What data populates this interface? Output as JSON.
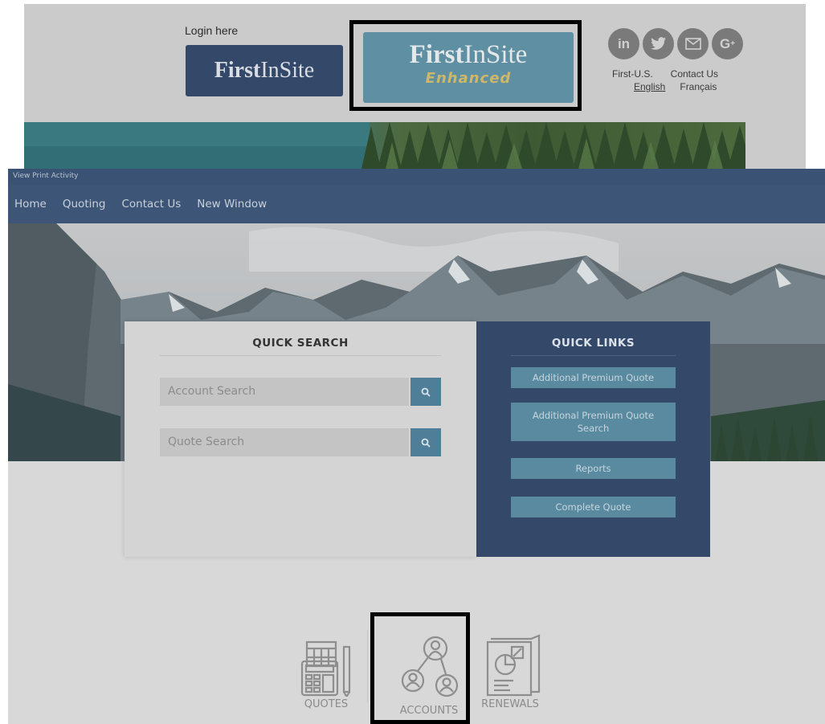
{
  "login": {
    "label": "Login here",
    "classic_bold": "First",
    "classic_light": "InSite",
    "enhanced_bold": "First",
    "enhanced_light": "InSite",
    "enhanced_sub": "Enhanced"
  },
  "social": {
    "items": [
      "in",
      "t",
      "mail",
      "G+"
    ],
    "first_us": "First-U.S.",
    "contact_us": "Contact Us",
    "english": "English",
    "francais": "Français"
  },
  "app": {
    "title_bar": "View Print Activity",
    "nav": [
      "Home",
      "Quoting",
      "Contact Us",
      "New Window"
    ]
  },
  "quick_search": {
    "title": "QUICK SEARCH",
    "account_placeholder": "Account Search",
    "quote_placeholder": "Quote Search"
  },
  "quick_links": {
    "title": "QUICK LINKS",
    "items": [
      "Additional Premium Quote",
      "Additional Premium Quote Search",
      "Reports",
      "Complete Quote"
    ]
  },
  "bottom_tabs": {
    "quotes": "QUOTES",
    "accounts": "ACCOUNTS",
    "renewals": "RENEWALS"
  },
  "colors": {
    "nav_bg": "#3d5576",
    "links_bg": "#34496a",
    "accent": "#5a8aa0",
    "highlight": "#000000"
  }
}
